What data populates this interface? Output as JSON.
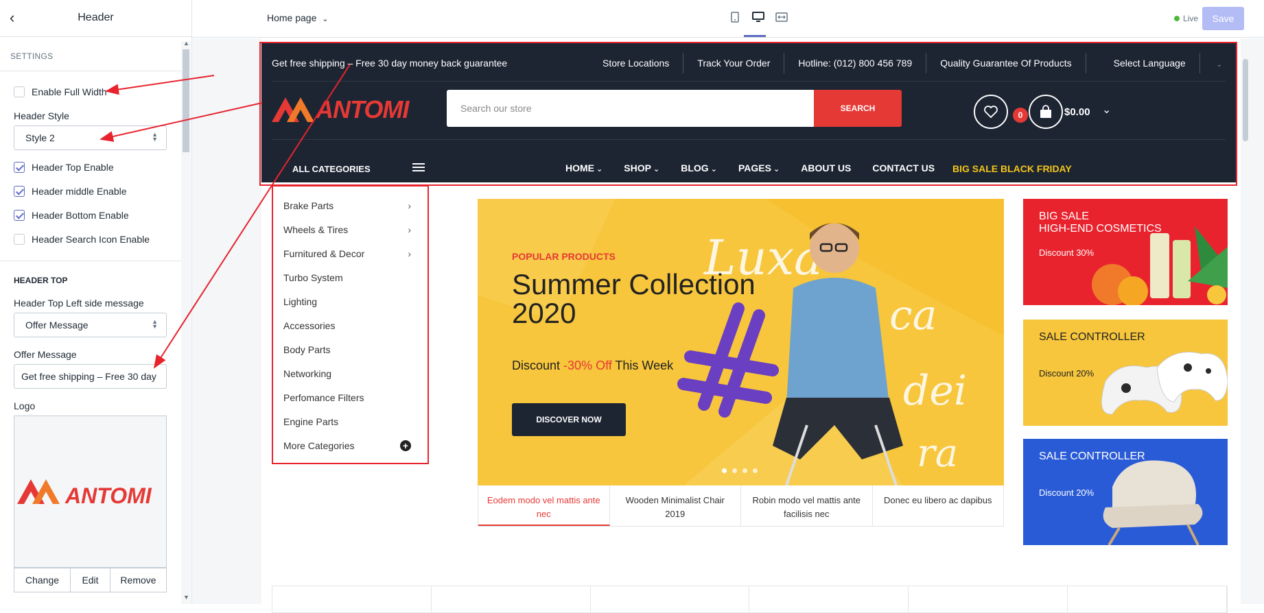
{
  "sidebar": {
    "title": "Header",
    "section": "SETTINGS",
    "enable_full_width": "Enable Full Width",
    "header_style_label": "Header Style",
    "header_style_value": "Style 2",
    "checkboxes": [
      {
        "label": "Header Top Enable",
        "checked": true
      },
      {
        "label": "Header middle Enable",
        "checked": true
      },
      {
        "label": "Header Bottom Enable",
        "checked": true
      },
      {
        "label": "Header Search Icon Enable",
        "checked": false
      }
    ],
    "header_top_heading": "HEADER TOP",
    "left_msg_label": "Header Top Left side message",
    "left_msg_value": "Offer Message",
    "offer_label": "Offer Message",
    "offer_value": "Get free shipping  – Free 30 day",
    "logo_label": "Logo",
    "logo_text": "ANTOMI",
    "logo_actions": [
      "Change",
      "Edit",
      "Remove"
    ]
  },
  "topbar": {
    "page": "Home page",
    "live": "Live",
    "save": "Save"
  },
  "store": {
    "top_left": "Get free shipping – Free 30 day money back guarantee",
    "top_links": [
      "Store Locations",
      "Track Your Order",
      "Hotline: (012) 800 456 789",
      "Quality Guarantee Of Products",
      "Select Language"
    ],
    "logo": "ANTOMI",
    "search_placeholder": "Search our store",
    "search_button": "SEARCH",
    "cart_count": "0",
    "cart_total": "$0.00",
    "all_categories": "ALL CATEGORIES",
    "nav": [
      "HOME",
      "SHOP",
      "BLOG",
      "PAGES",
      "ABOUT US",
      "CONTACT US"
    ],
    "promo": "BIG SALE BLACK FRIDAY",
    "categories": [
      "Brake Parts",
      "Wheels & Tires",
      "Furnitured & Decor",
      "Turbo System",
      "Lighting",
      "Accessories",
      "Body Parts",
      "Networking",
      "Perfomance Filters",
      "Engine Parts",
      "More Categories"
    ],
    "hero": {
      "kicker": "POPULAR PRODUCTS",
      "title": "Summer Collection 2020",
      "discount_pre": "Discount ",
      "discount_off": "-30% Off",
      "discount_post": " This Week",
      "button": "DISCOVER NOW"
    },
    "hero_tabs": [
      "Eodem modo vel mattis ante nec",
      "Wooden Minimalist Chair 2019",
      "Robin modo vel mattis ante facilisis nec",
      "Donec eu libero ac dapibus"
    ],
    "banners": [
      {
        "title": "BIG SALE\nHIGH-END COSMETICS",
        "sub": "Discount 30%",
        "bg": "#e8232e"
      },
      {
        "title": "SALE CONTROLLER",
        "sub": "Discount 20%",
        "bg": "#f7c63c"
      },
      {
        "title": "SALE CONTROLLER",
        "sub": "Discount 20%",
        "bg": "#2a5bd7"
      }
    ]
  },
  "colors": {
    "accent": "#e53935",
    "dark": "#1d2533",
    "admin": "#5c6ac4",
    "annotation": "#e8232e"
  }
}
